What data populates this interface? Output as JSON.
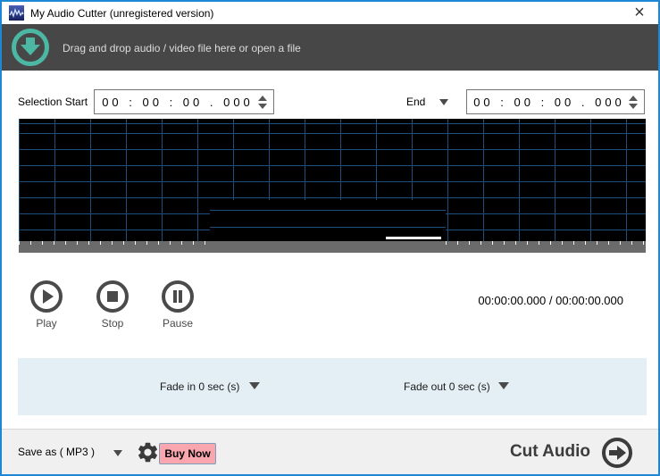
{
  "titlebar": {
    "title": "My Audio Cutter (unregistered version)",
    "close_label": "×"
  },
  "dropzone": {
    "message": "Drag and drop audio / video file here or open a file"
  },
  "selection": {
    "start_label": "Selection Start",
    "start_value": "00 : 00 : 00 . 000",
    "end_label": "End",
    "end_value": "00 : 00 : 00 . 000"
  },
  "transport": {
    "play_label": "Play",
    "stop_label": "Stop",
    "pause_label": "Pause",
    "time_display": "00:00:00.000 / 00:00:00.000"
  },
  "fade": {
    "fade_in_label": "Fade in 0 sec (s)",
    "fade_out_label": "Fade out 0 sec (s)"
  },
  "footer": {
    "save_as_label": "Save as ( MP3 )",
    "buy_now_label": "Buy Now",
    "cut_audio_label": "Cut Audio"
  },
  "colors": {
    "window_border": "#1e87d5",
    "dropzone_bg": "#474747",
    "accent_teal": "#4cb8a4",
    "waveform_grid_blue": "#1d4e7e",
    "scrollbar_gray": "#6b6b6b",
    "fade_bg": "#e4eef5",
    "buy_now_bg": "#f9a6ae",
    "footer_bg": "#f0f0f0"
  }
}
